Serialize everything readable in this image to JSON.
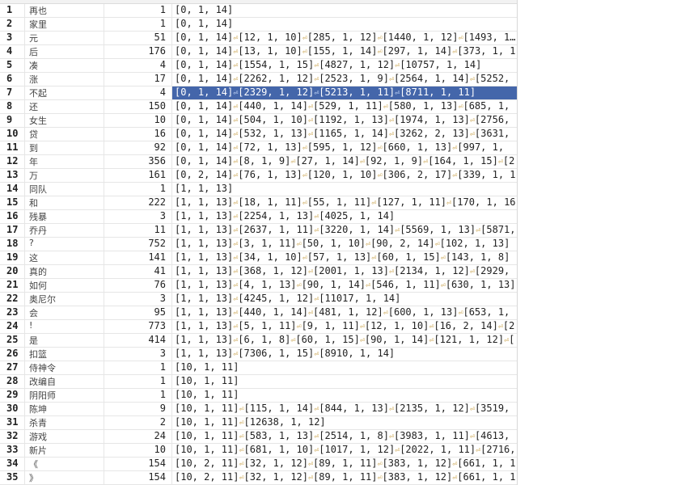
{
  "grid": {
    "selected_row": 7,
    "sep_glyph": "⏎",
    "rows": [
      {
        "n": "1",
        "word": "再也",
        "count": "1",
        "pos": "[0, 1, 14]"
      },
      {
        "n": "2",
        "word": "家里",
        "count": "1",
        "pos": "[0, 1, 14]"
      },
      {
        "n": "3",
        "word": "元",
        "count": "51",
        "pos": "[0, 1, 14]⏎[12, 1, 10]⏎[285, 1, 12]⏎[1440, 1, 12]⏎[1493, 1, 1"
      },
      {
        "n": "4",
        "word": "后",
        "count": "176",
        "pos": "[0, 1, 14]⏎[13, 1, 10]⏎[155, 1, 14]⏎[297, 1, 14]⏎[373, 1, 1"
      },
      {
        "n": "5",
        "word": "凑",
        "count": "4",
        "pos": "[0, 1, 14]⏎[1554, 1, 15]⏎[4827, 1, 12]⏎[10757, 1, 14]"
      },
      {
        "n": "6",
        "word": "涨",
        "count": "17",
        "pos": "[0, 1, 14]⏎[2262, 1, 12]⏎[2523, 1, 9]⏎[2564, 1, 14]⏎[5252,"
      },
      {
        "n": "7",
        "word": "不起",
        "count": "4",
        "pos": "[0, 1, 14]⏎[2329, 1, 12]⏎[5213, 1, 11]⏎[8711, 1, 11]"
      },
      {
        "n": "8",
        "word": "还",
        "count": "150",
        "pos": "[0, 1, 14]⏎[440, 1, 14]⏎[529, 1, 11]⏎[580, 1, 13]⏎[685, 1,"
      },
      {
        "n": "9",
        "word": "女生",
        "count": "10",
        "pos": "[0, 1, 14]⏎[504, 1, 10]⏎[1192, 1, 13]⏎[1974, 1, 13]⏎[2756,"
      },
      {
        "n": "10",
        "word": "贷",
        "count": "16",
        "pos": "[0, 1, 14]⏎[532, 1, 13]⏎[1165, 1, 14]⏎[3262, 2, 13]⏎[3631,"
      },
      {
        "n": "11",
        "word": "到",
        "count": "92",
        "pos": "[0, 1, 14]⏎[72, 1, 13]⏎[595, 1, 12]⏎[660, 1, 13]⏎[997, 1,"
      },
      {
        "n": "12",
        "word": "年",
        "count": "356",
        "pos": "[0, 1, 14]⏎[8, 1, 9]⏎[27, 1, 14]⏎[92, 1, 9]⏎[164, 1, 15]⏎[2"
      },
      {
        "n": "13",
        "word": "万",
        "count": "161",
        "pos": "[0, 2, 14]⏎[76, 1, 13]⏎[120, 1, 10]⏎[306, 2, 17]⏎[339, 1, 1"
      },
      {
        "n": "14",
        "word": "同队",
        "count": "1",
        "pos": "[1, 1, 13]"
      },
      {
        "n": "15",
        "word": "和",
        "count": "222",
        "pos": "[1, 1, 13]⏎[18, 1, 11]⏎[55, 1, 11]⏎[127, 1, 11]⏎[170, 1, 16"
      },
      {
        "n": "16",
        "word": "残暴",
        "count": "3",
        "pos": "[1, 1, 13]⏎[2254, 1, 13]⏎[4025, 1, 14]"
      },
      {
        "n": "17",
        "word": "乔丹",
        "count": "11",
        "pos": "[1, 1, 13]⏎[2637, 1, 11]⏎[3220, 1, 14]⏎[5569, 1, 13]⏎[5871,"
      },
      {
        "n": "18",
        "word": "?",
        "count": "752",
        "pos": "[1, 1, 13]⏎[3, 1, 11]⏎[50, 1, 10]⏎[90, 2, 14]⏎[102, 1, 13]"
      },
      {
        "n": "19",
        "word": "这",
        "count": "141",
        "pos": "[1, 1, 13]⏎[34, 1, 10]⏎[57, 1, 13]⏎[60, 1, 15]⏎[143, 1, 8]"
      },
      {
        "n": "20",
        "word": "真的",
        "count": "41",
        "pos": "[1, 1, 13]⏎[368, 1, 12]⏎[2001, 1, 13]⏎[2134, 1, 12]⏎[2929,"
      },
      {
        "n": "21",
        "word": "如何",
        "count": "76",
        "pos": "[1, 1, 13]⏎[4, 1, 13]⏎[90, 1, 14]⏎[546, 1, 11]⏎[630, 1, 13]"
      },
      {
        "n": "22",
        "word": "奥尼尔",
        "count": "3",
        "pos": "[1, 1, 13]⏎[4245, 1, 12]⏎[11017, 1, 14]"
      },
      {
        "n": "23",
        "word": "会",
        "count": "95",
        "pos": "[1, 1, 13]⏎[440, 1, 14]⏎[481, 1, 12]⏎[600, 1, 13]⏎[653, 1,"
      },
      {
        "n": "24",
        "word": "!",
        "count": "773",
        "pos": "[1, 1, 13]⏎[5, 1, 11]⏎[9, 1, 11]⏎[12, 1, 10]⏎[16, 2, 14]⏎[2"
      },
      {
        "n": "25",
        "word": "是",
        "count": "414",
        "pos": "[1, 1, 13]⏎[6, 1, 8]⏎[60, 1, 15]⏎[90, 1, 14]⏎[121, 1, 12]⏎["
      },
      {
        "n": "26",
        "word": "扣篮",
        "count": "3",
        "pos": "[1, 1, 13]⏎[7306, 1, 15]⏎[8910, 1, 14]"
      },
      {
        "n": "27",
        "word": "侍神令",
        "count": "1",
        "pos": "[10, 1, 11]"
      },
      {
        "n": "28",
        "word": "改编自",
        "count": "1",
        "pos": "[10, 1, 11]"
      },
      {
        "n": "29",
        "word": "阴阳师",
        "count": "1",
        "pos": "[10, 1, 11]"
      },
      {
        "n": "30",
        "word": "陈坤",
        "count": "9",
        "pos": "[10, 1, 11]⏎[115, 1, 14]⏎[844, 1, 13]⏎[2135, 1, 12]⏎[3519,"
      },
      {
        "n": "31",
        "word": "杀青",
        "count": "2",
        "pos": "[10, 1, 11]⏎[12638, 1, 12]"
      },
      {
        "n": "32",
        "word": "游戏",
        "count": "24",
        "pos": "[10, 1, 11]⏎[583, 1, 13]⏎[2514, 1, 8]⏎[3983, 1, 11]⏎[4613,"
      },
      {
        "n": "33",
        "word": "新片",
        "count": "10",
        "pos": "[10, 1, 11]⏎[681, 1, 10]⏎[1017, 1, 12]⏎[2022, 1, 11]⏎[2716,"
      },
      {
        "n": "34",
        "word": "《",
        "count": "154",
        "pos": "[10, 2, 11]⏎[32, 1, 12]⏎[89, 1, 11]⏎[383, 1, 12]⏎[661, 1, 1"
      },
      {
        "n": "35",
        "word": "》",
        "count": "154",
        "pos": "[10, 2, 11]⏎[32, 1, 12]⏎[89, 1, 11]⏎[383, 1, 12]⏎[661, 1, 1"
      }
    ]
  }
}
